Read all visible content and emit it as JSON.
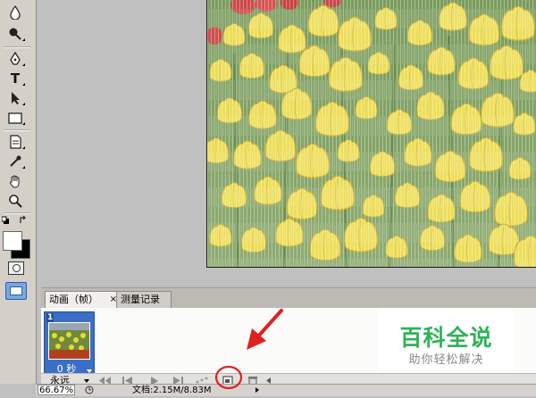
{
  "tools": [
    {
      "icon": "blur-drop-icon"
    },
    {
      "icon": "dodge-icon"
    },
    {
      "icon": "pen-icon"
    },
    {
      "icon": "type-icon",
      "glyph": "T"
    },
    {
      "icon": "path-select-icon"
    },
    {
      "icon": "rectangle-icon"
    },
    {
      "icon": "notes-icon"
    },
    {
      "icon": "eyedropper-icon"
    },
    {
      "icon": "hand-icon"
    },
    {
      "icon": "zoom-icon"
    }
  ],
  "colors": {
    "foreground": "#ffffff",
    "background": "#000000",
    "selected_frame": "#3b6fc6",
    "annotation": "#e02020",
    "watermark_text": "#2fb25a"
  },
  "palette": {
    "tabs": [
      {
        "label": "动画（帧）",
        "close": "×",
        "active": true
      },
      {
        "label": "测量记录",
        "active": false
      }
    ],
    "frames": [
      {
        "number": "1",
        "delay": "0 秒",
        "selected": true
      }
    ],
    "loop": "永远",
    "controls": [
      "first-frame-icon",
      "previous-frame-icon",
      "play-icon",
      "next-frame-icon",
      "tween-icon",
      "new-frame-icon",
      "delete-frame-icon"
    ]
  },
  "status": {
    "zoom": "66.67%",
    "doc_info": "文档:2.15M/8.83M"
  },
  "watermark": {
    "title": "百科全说",
    "subtitle": "助你轻松解决"
  }
}
